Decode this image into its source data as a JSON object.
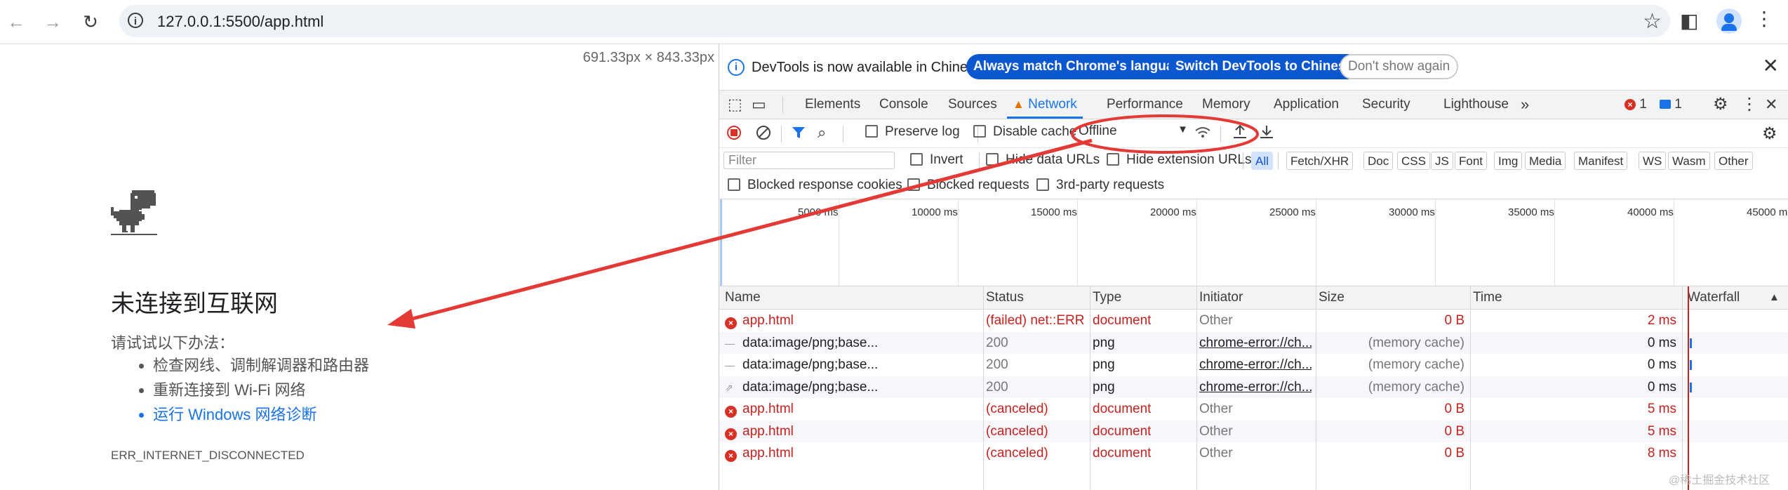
{
  "browser": {
    "url": "127.0.0.1:5500/app.html"
  },
  "page": {
    "viewport_size_label": "691.33px × 843.33px",
    "title": "未连接到互联网",
    "try_text": "请试试以下办法：",
    "tips": [
      "检查网线、调制解调器和路由器",
      "重新连接到 Wi-Fi 网络",
      "运行 Windows 网络诊断"
    ],
    "error_code": "ERR_INTERNET_DISCONNECTED"
  },
  "devtools": {
    "infobar": {
      "message": "DevTools is now available in Chinese!",
      "btn_match": "Always match Chrome's language",
      "btn_switch": "Switch DevTools to Chinese",
      "btn_dismiss": "Don't show again"
    },
    "tabs": [
      "Elements",
      "Console",
      "Sources",
      "Network",
      "Performance",
      "Memory",
      "Application",
      "Security",
      "Lighthouse"
    ],
    "more_tabs": "»",
    "error_count": "1",
    "message_count": "1",
    "toolbar": {
      "preserve_log": "Preserve log",
      "disable_cache": "Disable cache",
      "throttling": "Offline"
    },
    "filter": {
      "placeholder": "Filter",
      "invert": "Invert",
      "hide_data_urls": "Hide data URLs",
      "hide_extension_urls": "Hide extension URLs",
      "types": [
        "All",
        "Fetch/XHR",
        "Doc",
        "CSS",
        "JS",
        "Font",
        "Img",
        "Media",
        "Manifest",
        "WS",
        "Wasm",
        "Other"
      ],
      "blocked_cookies": "Blocked response cookies",
      "blocked_requests": "Blocked requests",
      "third_party": "3rd-party requests"
    },
    "overview_ticks": [
      "5000 ms",
      "10000 ms",
      "15000 ms",
      "20000 ms",
      "25000 ms",
      "30000 ms",
      "35000 ms",
      "40000 ms",
      "45000 m"
    ],
    "columns": [
      "Name",
      "Status",
      "Type",
      "Initiator",
      "Size",
      "Time",
      "Waterfall"
    ],
    "rows": [
      {
        "name": "app.html",
        "status": "(failed) net::ERR...",
        "type": "document",
        "initiator": "Other",
        "size": "0 B",
        "time": "2 ms",
        "kind": "error"
      },
      {
        "name": "data:image/png;base...",
        "status": "200",
        "type": "png",
        "initiator": "chrome-error://ch...",
        "size": "(memory cache)",
        "time": "0 ms",
        "kind": "data"
      },
      {
        "name": "data:image/png;base...",
        "status": "200",
        "type": "png",
        "initiator": "chrome-error://ch...",
        "size": "(memory cache)",
        "time": "0 ms",
        "kind": "data"
      },
      {
        "name": "data:image/png;base...",
        "status": "200",
        "type": "png",
        "initiator": "chrome-error://ch...",
        "size": "(memory cache)",
        "time": "0 ms",
        "kind": "data"
      },
      {
        "name": "app.html",
        "status": "(canceled)",
        "type": "document",
        "initiator": "Other",
        "size": "0 B",
        "time": "5 ms",
        "kind": "error"
      },
      {
        "name": "app.html",
        "status": "(canceled)",
        "type": "document",
        "initiator": "Other",
        "size": "0 B",
        "time": "5 ms",
        "kind": "error"
      },
      {
        "name": "app.html",
        "status": "(canceled)",
        "type": "document",
        "initiator": "Other",
        "size": "0 B",
        "time": "8 ms",
        "kind": "error"
      }
    ]
  },
  "watermark": "@稀土掘金技术社区",
  "colors": {
    "accent": "#1a73e8",
    "error": "#c5221f",
    "annotation": "#e53935"
  }
}
